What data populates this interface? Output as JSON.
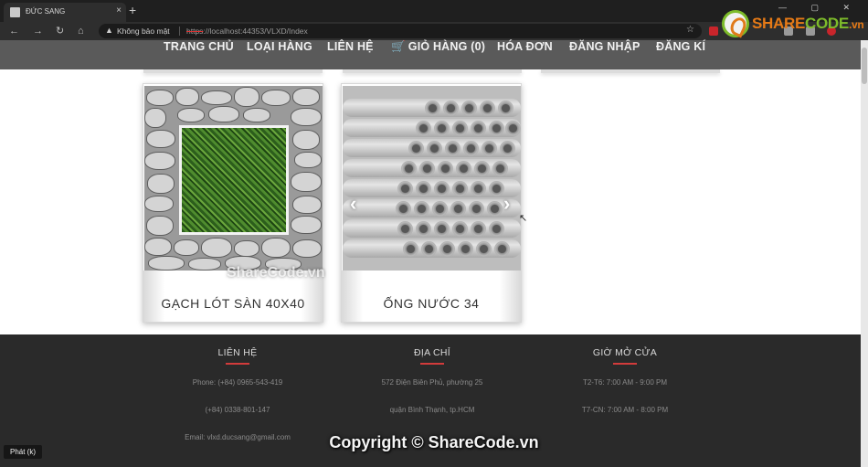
{
  "browser": {
    "tab_title": "ĐỨC SANG",
    "security_label": "Không bảo mật",
    "url_scheme": "https",
    "url_rest": "://localhost:44353/VLXD/Index",
    "close_glyph": "×",
    "newtab_glyph": "+"
  },
  "nav": {
    "items": [
      {
        "label": "TRANG CHỦ"
      },
      {
        "label": "LOẠI HÀNG"
      },
      {
        "label": "LIÊN HỆ"
      },
      {
        "label": "GIỎ HÀNG (0)"
      },
      {
        "label": "HÓA ĐƠN"
      },
      {
        "label": "ĐĂNG NHẬP"
      },
      {
        "label": "ĐĂNG KÍ"
      }
    ]
  },
  "products": [
    {
      "name": "GẠCH LÓT SÀN 40X40"
    },
    {
      "name": "ỐNG NƯỚC 34"
    }
  ],
  "footer": {
    "contact": {
      "title": "LIÊN HỆ",
      "lines": [
        "Phone: (+84) 0965-543-419",
        "(+84) 0338-801-147",
        "Email: vlxd.ducsang@gmail.com"
      ]
    },
    "address": {
      "title": "ĐỊA CHỈ",
      "lines": [
        "572 Điện Biên Phủ, phường 25",
        "quận Bình Thạnh, tp.HCM"
      ]
    },
    "hours": {
      "title": "GIỜ MỞ CỬA",
      "lines": [
        "T2-T6: 7:00 AM - 9:00 PM",
        "T7-CN: 7:00 AM - 8:00 PM"
      ]
    }
  },
  "watermark": {
    "brand_a": "SHARE",
    "brand_b": "CODE",
    "brand_c": ".vn",
    "center": "ShareCode.vn",
    "copyright": "Copyright © ShareCode.vn"
  },
  "overlay": {
    "caption_button": "Phát (k)"
  },
  "colors": {
    "navbar": "#5a5a5a",
    "footer": "#2a2a2a",
    "footer_accent": "#d23b3b",
    "cart_icon": "#f0c020"
  }
}
